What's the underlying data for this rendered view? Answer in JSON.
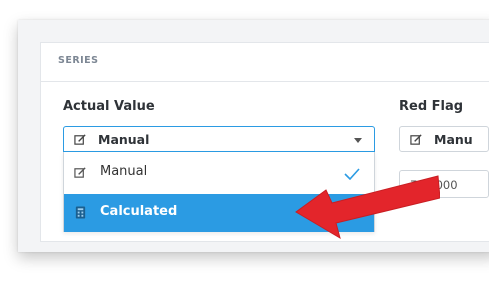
{
  "panel": {
    "title": "SERIES"
  },
  "actual_value": {
    "label": "Actual Value",
    "selected": "Manual",
    "options": [
      {
        "label": "Manual",
        "icon": "edit-icon",
        "checked": true
      },
      {
        "label": "Calculated",
        "icon": "calculator-icon",
        "highlighted": true
      }
    ]
  },
  "red_flag": {
    "label": "Red Flag",
    "selected": "Manu",
    "value": "761,000"
  },
  "colors": {
    "accent": "#2b9be3",
    "arrow": "#e3252b",
    "panel_bg": "#ffffff",
    "outer_bg": "#f3f4f6"
  }
}
